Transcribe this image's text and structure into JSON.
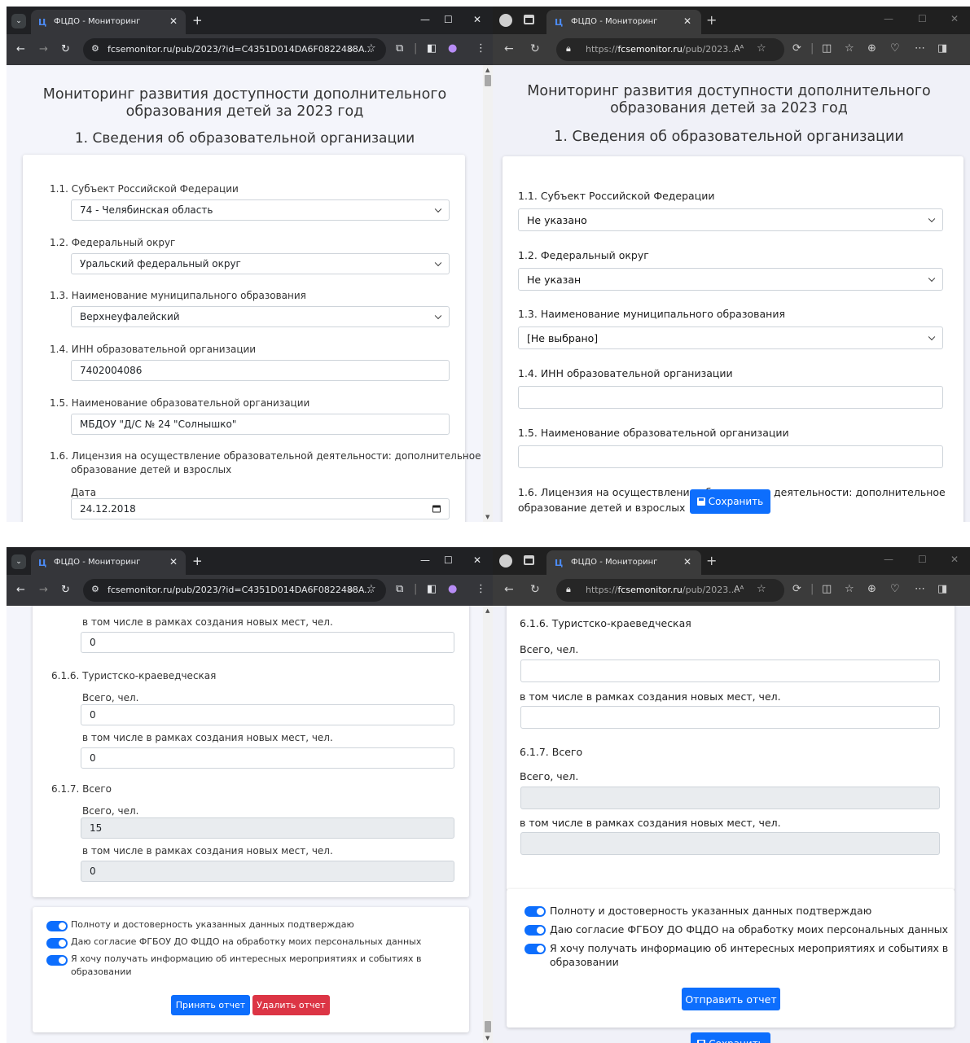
{
  "browser": {
    "tab_title": "ФЦДО - Мониторинг",
    "chrome_url": "fcsemonitor.ru/pub/2023/?id=C4351D014DA6F0822488A...",
    "edge_url_prefix": "https://",
    "edge_url_host": "fcsemonitor.ru",
    "edge_url_rest": "/pub/2023...",
    "edge_read_aloud": "Aᴬ"
  },
  "page": {
    "title_line1": "Мониторинг развития доступности дополнительного",
    "title_line2": "образования детей за 2023 год",
    "section_title": "1. Сведения об образовательной организации",
    "save_label": "Сохранить"
  },
  "form_filled": {
    "l11": "1.1.  Субъект Российской Федерации",
    "v11": "74 - Челябинская область",
    "l12": "1.2.  Федеральный округ",
    "v12": "Уральский федеральный округ",
    "l13": "1.3.  Наименование муниципального образования",
    "v13": "Верхнеуфалейский",
    "l14": "1.4.  ИНН образовательной организации",
    "v14": "7402004086",
    "l15": "1.5.  Наименование образовательной организации",
    "v15": "МБДОУ \"Д/С № 24 \"Солнышко\"",
    "l16a": "1.6.  Лицензия на осуществление образовательной деятельности: дополнительное",
    "l16b": "образование детей и взрослых",
    "date_label": "Дата",
    "date_value": "24.12.2018"
  },
  "form_empty": {
    "l11": "1.1. Субъект Российской Федерации",
    "v11": "Не указано",
    "l12": "1.2. Федеральный округ",
    "v12": "Не указан",
    "l13": "1.3. Наименование муниципального образования",
    "v13": "[Не выбрано]",
    "l14": "1.4. ИНН образовательной организации",
    "l15": "1.5. Наименование образовательной организации",
    "l16_left": "1.6. Лицензия на осуществление об",
    "l16_right": "деятельности: дополнительное",
    "l16b": "образование детей и взрослых"
  },
  "section6_filled": {
    "new_places_label": "в том числе в рамках создания новых мест, чел.",
    "v_prev": "0",
    "l616": "6.1.6.  Туристско-краеведческая",
    "total_label": "Всего, чел.",
    "v616_total": "0",
    "v616_new": "0",
    "l617": "6.1.7.  Всего",
    "v617_total": "15",
    "v617_new": "0"
  },
  "section6_empty": {
    "l616": "6.1.6. Туристско-краеведческая",
    "total_label": "Всего, чел.",
    "new_places_label": "в том числе в рамках создания новых мест, чел.",
    "l617": "6.1.7. Всего"
  },
  "consents": {
    "c1": "Полноту и достоверность указанных данных подтверждаю",
    "c2": "Даю согласие ФГБОУ ДО ФЦДО на обработку моих персональных данных",
    "c3a": "Я хочу получать информацию об интересных мероприятиях и событиях в",
    "c3b": "образовании"
  },
  "actions": {
    "accept": "Принять отчет",
    "delete": "Удалить отчет",
    "send": "Отправить отчет"
  },
  "colors": {
    "primary": "#0d6efd",
    "danger": "#dc3545",
    "page_bg": "#f4f5fb"
  }
}
